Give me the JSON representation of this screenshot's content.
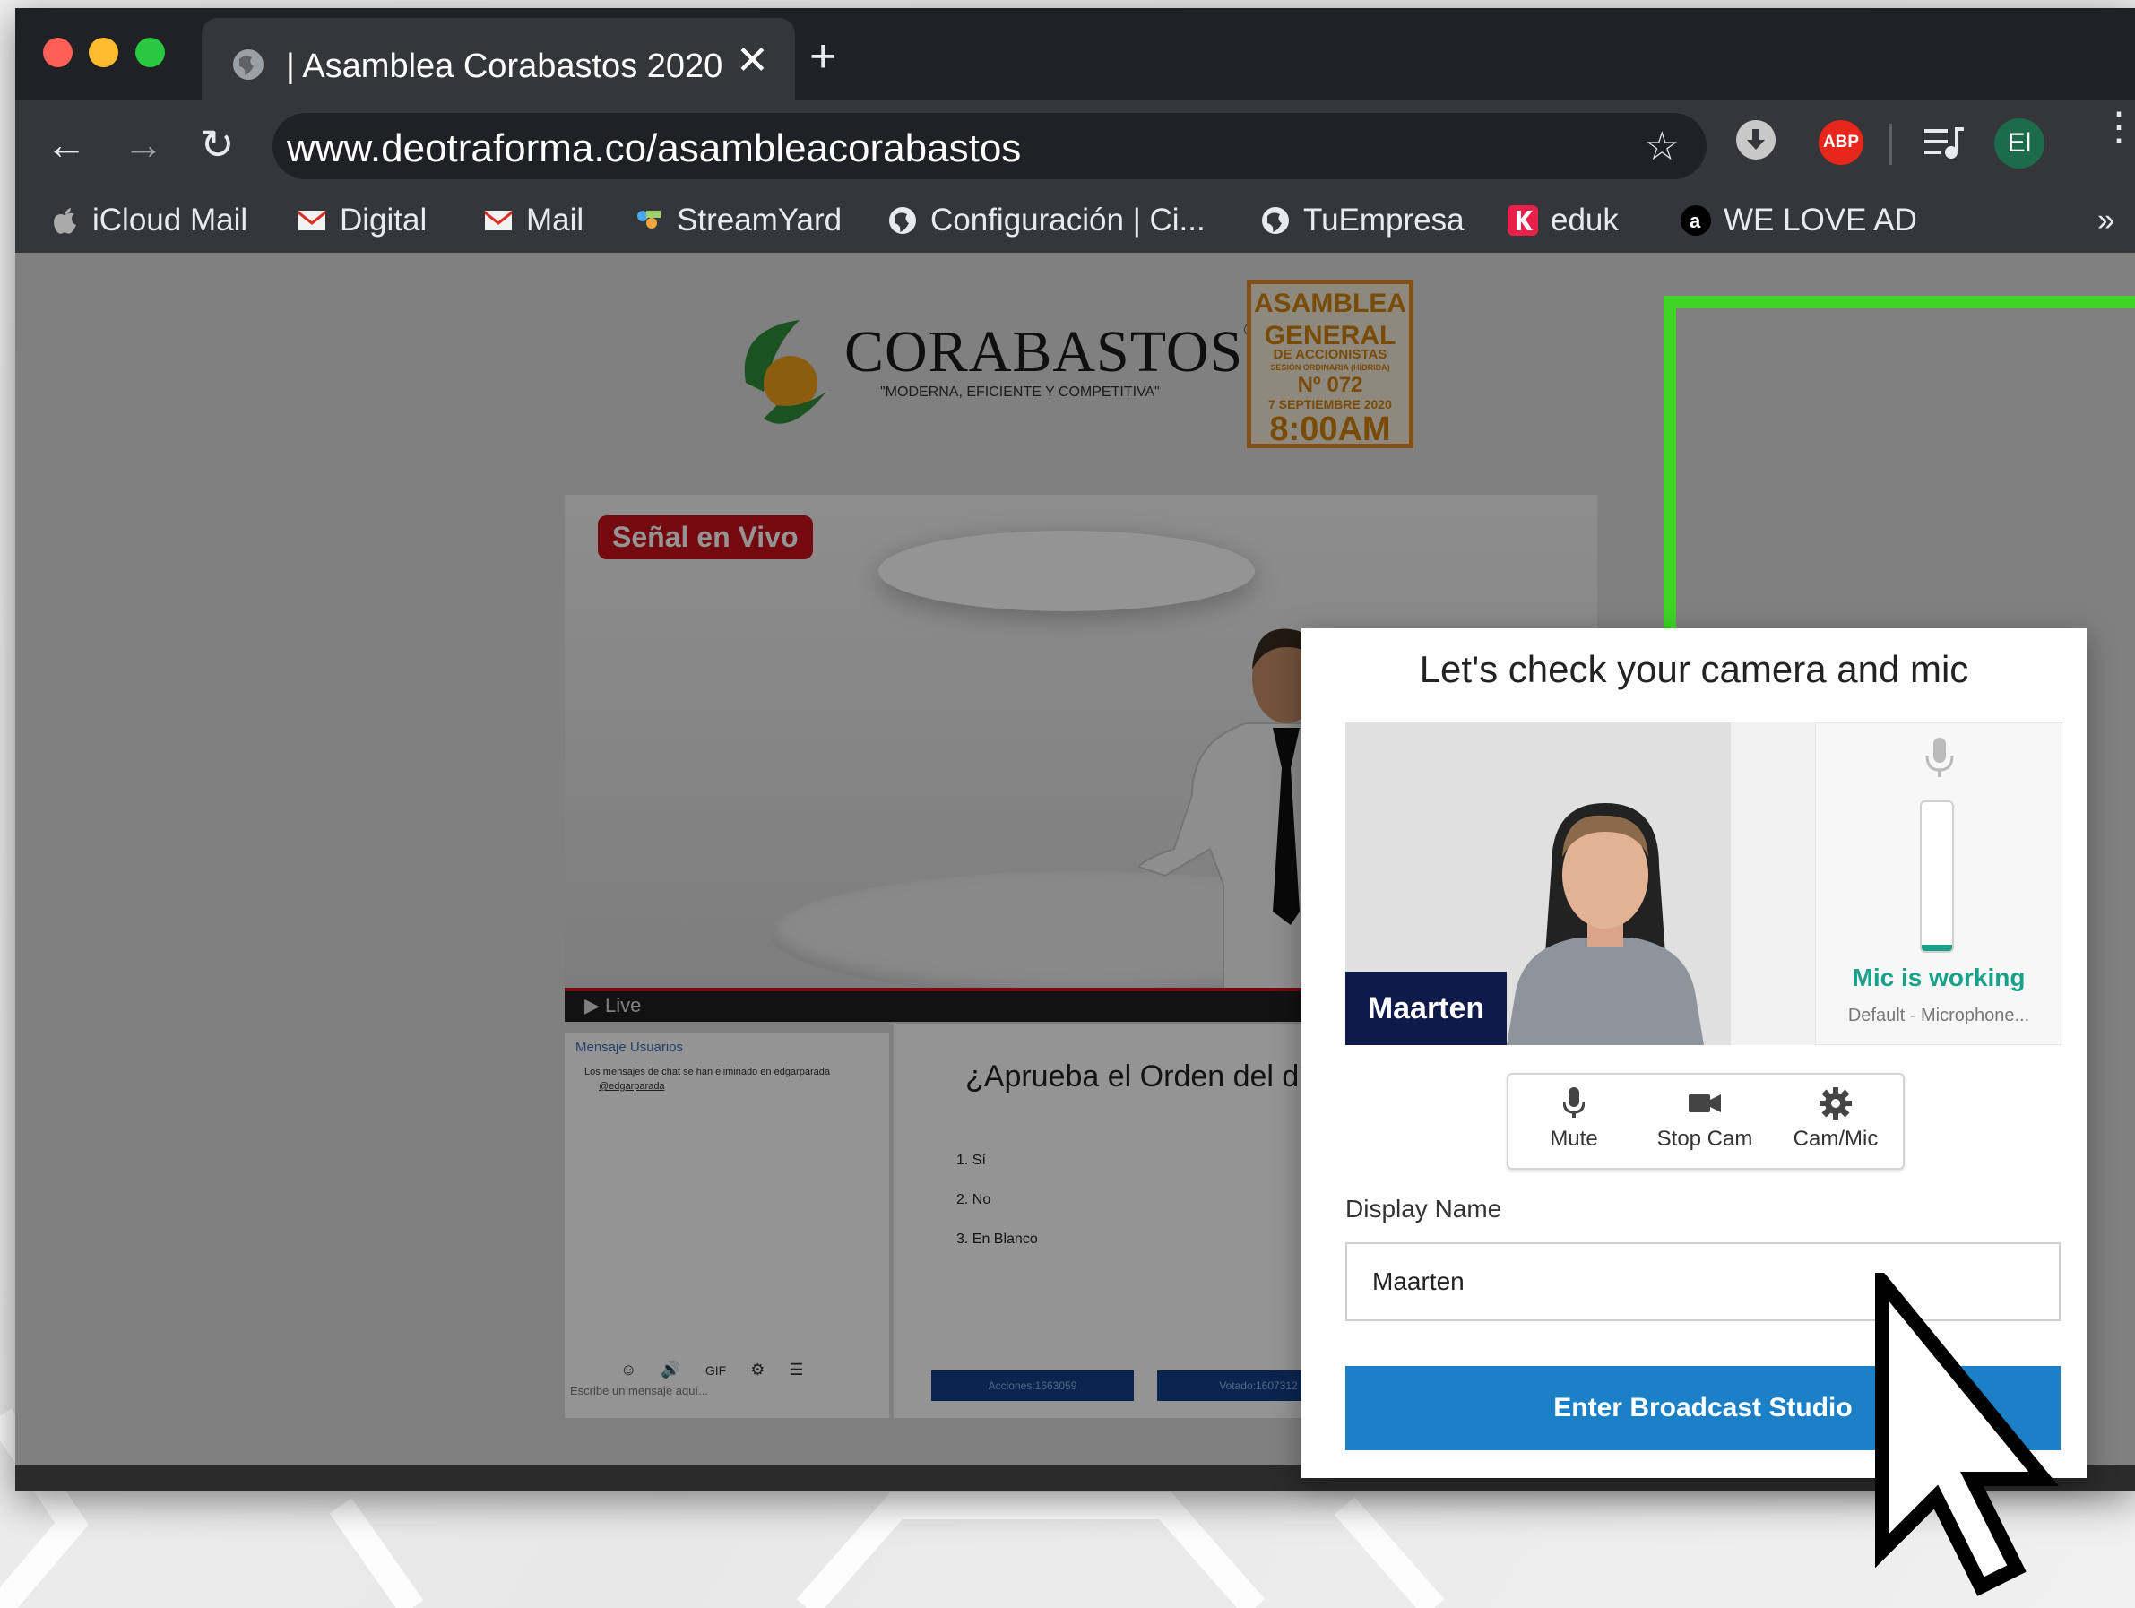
{
  "browser": {
    "tab_title": "| Asamblea Corabastos 2020",
    "tab_close": "✕",
    "new_tab": "+",
    "url": "www.deotraforma.co/asambleacorabastos",
    "abp_label": "ABP",
    "avatar_initials": "El",
    "bookmarks_overflow": "»",
    "bookmarks": [
      {
        "label": "iCloud Mail",
        "icon": "apple-icon"
      },
      {
        "label": "Digital",
        "icon": "gmail-icon"
      },
      {
        "label": "Mail",
        "icon": "gmail-icon"
      },
      {
        "label": "StreamYard",
        "icon": "streamyard-icon"
      },
      {
        "label": "Configuración | Ci...",
        "icon": "globe-icon"
      },
      {
        "label": "TuEmpresa",
        "icon": "globe-icon"
      },
      {
        "label": "eduk",
        "icon": "eduk-icon"
      },
      {
        "label": "WE LOVE AD",
        "icon": "amazon-icon"
      }
    ]
  },
  "page": {
    "brand": "CORABASTOS",
    "brand_mark": "®",
    "tagline": "\"MODERNA, EFICIENTE Y COMPETITIVA\"",
    "badge": {
      "line1": "ASAMBLEA",
      "line1b": "GENERAL",
      "line2": "DE ACCIONISTAS",
      "line2b": "SESIÓN ORDINARIA (HÍBRIDA)",
      "line3": "Nº 072",
      "line4": "7 SEPTIEMBRE 2020",
      "line5": "8:00AM"
    },
    "live_badge": "Señal en Vivo",
    "live_bar": "▶ Live",
    "chat": {
      "tabs": "Mensaje  Usuarios",
      "notice": "Los mensajes de chat se han eliminado en edgarparada",
      "notice_user": "@edgarparada",
      "gif": "GIF",
      "placeholder": "Escribe un mensaje aquí..."
    },
    "poll": {
      "question": "¿Aprueba el Orden del día?",
      "options": [
        "1.  Sí",
        "2.  No",
        "3.  En Blanco"
      ],
      "acciones": "Acciones:1663059",
      "votado": "Votado:1607312"
    }
  },
  "dialog": {
    "title": "Let's check your camera and mic",
    "name_tag": "Maarten",
    "mic_status": "Mic is working",
    "mic_device": "Default - Microphone...",
    "mic_level": 0.04,
    "controls": [
      {
        "label": "Mute",
        "icon": "microphone-icon"
      },
      {
        "label": "Stop Cam",
        "icon": "camera-icon"
      },
      {
        "label": "Cam/Mic",
        "icon": "gear-icon"
      }
    ],
    "display_name_label": "Display Name",
    "display_name_value": "Maarten",
    "enter_button": "Enter Broadcast Studio"
  },
  "colors": {
    "accent_blue": "#1b80c5",
    "mic_green": "#1aa18a",
    "overlay_green": "#3fd427",
    "live_red": "#c8121a",
    "name_tag_navy": "#0d1a4a"
  }
}
